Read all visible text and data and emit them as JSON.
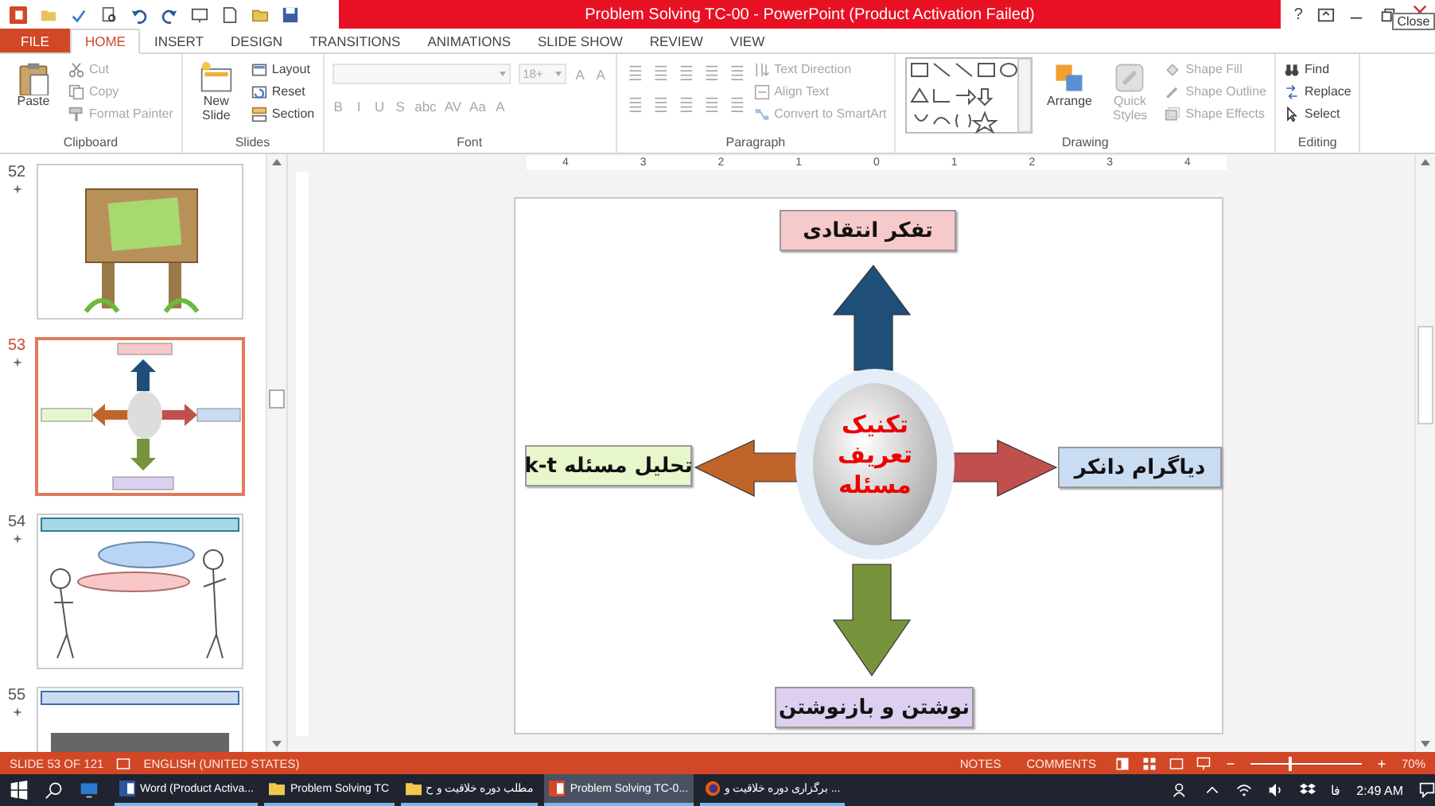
{
  "window": {
    "title": "Problem Solving TC-00 -  PowerPoint (Product Activation Failed)",
    "help": "?",
    "tooltip": "Close"
  },
  "tabs": [
    {
      "label": "FILE",
      "kind": "file",
      "selected": false
    },
    {
      "label": "HOME",
      "kind": "tab",
      "selected": true
    },
    {
      "label": "INSERT",
      "kind": "tab",
      "selected": false
    },
    {
      "label": "DESIGN",
      "kind": "tab",
      "selected": false
    },
    {
      "label": "TRANSITIONS",
      "kind": "tab",
      "selected": false
    },
    {
      "label": "ANIMATIONS",
      "kind": "tab",
      "selected": false
    },
    {
      "label": "SLIDE SHOW",
      "kind": "tab",
      "selected": false
    },
    {
      "label": "REVIEW",
      "kind": "tab",
      "selected": false
    },
    {
      "label": "VIEW",
      "kind": "tab",
      "selected": false
    }
  ],
  "ribbon": [
    {
      "label": "Clipboard",
      "kind": "standard",
      "large": [
        {
          "label": "Paste",
          "disabled": false
        }
      ],
      "columns": [
        [
          {
            "label": "Cut",
            "disabled": true
          },
          {
            "label": "Copy",
            "disabled": true
          },
          {
            "label": "Format Painter",
            "disabled": true
          }
        ]
      ]
    },
    {
      "label": "Slides",
      "kind": "standard",
      "large": [
        {
          "label": "New Slide",
          "disabled": false
        }
      ],
      "columns": [
        [
          {
            "label": "Layout",
            "disabled": false
          },
          {
            "label": "Reset",
            "disabled": false
          },
          {
            "label": "Section",
            "disabled": false
          }
        ]
      ]
    },
    {
      "label": "Font",
      "kind": "font",
      "rows": [
        [
          {
            "kind": "field",
            "disabled": true
          },
          {
            "kind": "field",
            "value": "18+",
            "disabled": true
          },
          {
            "kind": "glyph",
            "label": "A",
            "disabled": true
          },
          {
            "kind": "glyph",
            "label": "A",
            "disabled": true
          }
        ],
        [
          {
            "kind": "glyph",
            "label": "B",
            "disabled": true
          },
          {
            "kind": "glyph",
            "label": "I",
            "disabled": true
          },
          {
            "kind": "glyph",
            "label": "U",
            "disabled": true
          },
          {
            "kind": "glyph",
            "label": "S",
            "disabled": true
          },
          {
            "kind": "glyph",
            "label": "abc",
            "disabled": true
          },
          {
            "kind": "glyph",
            "label": "AV",
            "disabled": true
          },
          {
            "kind": "glyph",
            "label": "Aa",
            "disabled": true
          },
          {
            "kind": "glyph",
            "label": "A",
            "disabled": true
          }
        ]
      ]
    },
    {
      "label": "Paragraph",
      "kind": "paragraph",
      "columns": [
        [
          {
            "label": "Text Direction",
            "disabled": true
          },
          {
            "label": "Align Text",
            "disabled": true
          },
          {
            "label": "Convert to SmartArt",
            "disabled": true
          }
        ]
      ]
    },
    {
      "label": "Drawing",
      "kind": "drawing",
      "large": [
        {
          "label": "Arrange",
          "disabled": false
        },
        {
          "label": "Quick Styles",
          "disabled": true
        }
      ],
      "columns": [
        [
          {
            "label": "Shape Fill",
            "disabled": true
          },
          {
            "label": "Shape Outline",
            "disabled": true
          },
          {
            "label": "Shape Effects",
            "disabled": true
          }
        ]
      ]
    },
    {
      "label": "Editing",
      "kind": "standard",
      "columns": [
        [
          {
            "label": "Find",
            "disabled": false
          },
          {
            "label": "Replace",
            "disabled": false
          },
          {
            "label": "Select",
            "disabled": false
          }
        ]
      ]
    }
  ],
  "ruler": [
    "4",
    "3",
    "2",
    "1",
    "0",
    "1",
    "2",
    "3",
    "4"
  ],
  "thumbnails": [
    {
      "number": "52",
      "kind": "signboard",
      "selected": false
    },
    {
      "number": "53",
      "kind": "diagram",
      "selected": true
    },
    {
      "number": "54",
      "kind": "figures",
      "selected": false
    },
    {
      "number": "55",
      "kind": "header",
      "selected": false
    }
  ],
  "slide": {
    "center_lines": [
      "تکنیک",
      "تعریف",
      "مسئله"
    ],
    "branches": [
      {
        "label": "تفکر انتقادی",
        "color": "#f6c9cb"
      },
      {
        "label": "دیاگرام دانکر",
        "color": "#c9dcf2"
      },
      {
        "label": "تحلیل مسئله k-t",
        "color": "#e8f6cc"
      },
      {
        "label": "نوشتن و بازنوشتن",
        "color": "#dccff0"
      }
    ]
  },
  "status_bar": {
    "slide": "SLIDE 53 OF 121",
    "language": "ENGLISH (UNITED STATES)",
    "notes": "NOTES",
    "comments": "COMMENTS",
    "zoom": "70%",
    "level": 0.35
  },
  "taskbar": {
    "items": [
      {
        "label": "Word (Product Activa...",
        "kind": "word",
        "selected": false
      },
      {
        "label": "Problem Solving TC",
        "kind": "folder",
        "selected": false
      },
      {
        "label": "مطلب دوره خلاقیت و ح",
        "kind": "folder",
        "selected": false
      },
      {
        "label": "Problem Solving TC-0...",
        "kind": "powerpoint",
        "selected": true
      },
      {
        "label": "برگزاری دوره خلاقیت و ...",
        "kind": "firefox",
        "selected": false
      }
    ],
    "input_language": "فا",
    "time": "2:49 AM"
  }
}
